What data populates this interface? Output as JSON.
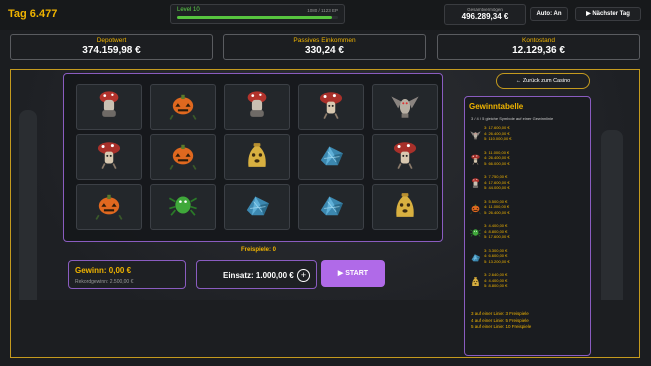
{
  "header": {
    "day": "Tag 6.477",
    "level_label": "Level 10",
    "level_xp": "1080 / 1123 EP",
    "level_progress": 0.96,
    "wealth_label": "Gesamtvermögen",
    "wealth_value": "496.289,34 €",
    "auto_label": "Auto: An",
    "next_label": "▶ Nächster Tag"
  },
  "stats": [
    {
      "label": "Depotwert",
      "value": "374.159,98 €"
    },
    {
      "label": "Passives Einkommen",
      "value": "330,24 €"
    },
    {
      "label": "Kontostand",
      "value": "12.129,36 €"
    }
  ],
  "slot": {
    "grid": [
      [
        "gnome-mushroom-icon",
        "pumpkin-monster-icon",
        "gnome-mushroom-icon",
        "mushroom-creature-icon",
        "bat-gargoyle-icon"
      ],
      [
        "mushroom-creature-icon",
        "pumpkin-monster-icon",
        "ghost-bag-icon",
        "blue-crystal-icon",
        "mushroom-creature-icon"
      ],
      [
        "pumpkin-monster-icon",
        "green-spider-icon",
        "blue-crystal-icon",
        "blue-crystal-icon",
        "ghost-bag-icon"
      ]
    ],
    "free_spins": "Freispiele: 0",
    "win_label": "Gewinn: 0,00 €",
    "record_label": "Rekordgewinn: 2.500,00 €",
    "bet_label": "Einsatz: 1.000,00 €",
    "plus_label": "+",
    "start_label": "▶ START",
    "back_label": "← Zurück zum Casino"
  },
  "paytable": {
    "title": "Gewinntabelle",
    "subtitle": "3 / 4 / 5 gleiche Symbole auf einer Gewinnlinie",
    "rows": [
      {
        "icon": "bat-gargoyle-icon",
        "v3": "3: 17.600,00 €",
        "v4": "4: 26.400,00 €",
        "v5": "5: 110.000,00 €"
      },
      {
        "icon": "mushroom-creature-icon",
        "v3": "3: 11.000,00 €",
        "v4": "4: 26.400,00 €",
        "v5": "5: 66.000,00 €"
      },
      {
        "icon": "gnome-mushroom-icon",
        "v3": "3: 7.750,00 €",
        "v4": "4: 17.600,00 €",
        "v5": "5: 44.000,00 €"
      },
      {
        "icon": "pumpkin-monster-icon",
        "v3": "3: 5.500,00 €",
        "v4": "4: 11.000,00 €",
        "v5": "5: 26.400,00 €"
      },
      {
        "icon": "green-spider-icon",
        "v3": "3: 4.400,00 €",
        "v4": "4: 8.800,00 €",
        "v5": "5: 17.600,00 €"
      },
      {
        "icon": "blue-crystal-icon",
        "v3": "3: 3.300,00 €",
        "v4": "4: 6.600,00 €",
        "v5": "5: 13.200,00 €"
      },
      {
        "icon": "ghost-bag-icon",
        "v3": "3: 2.640,00 €",
        "v4": "4: 4.400,00 €",
        "v5": "5: 8.800,00 €"
      }
    ],
    "free_lines": [
      "3 auf einer Linie: 3 Freispiele",
      "4 auf einer Linie: 5 Freispiele",
      "5 auf einer Linie: 10 Freispiele"
    ]
  }
}
